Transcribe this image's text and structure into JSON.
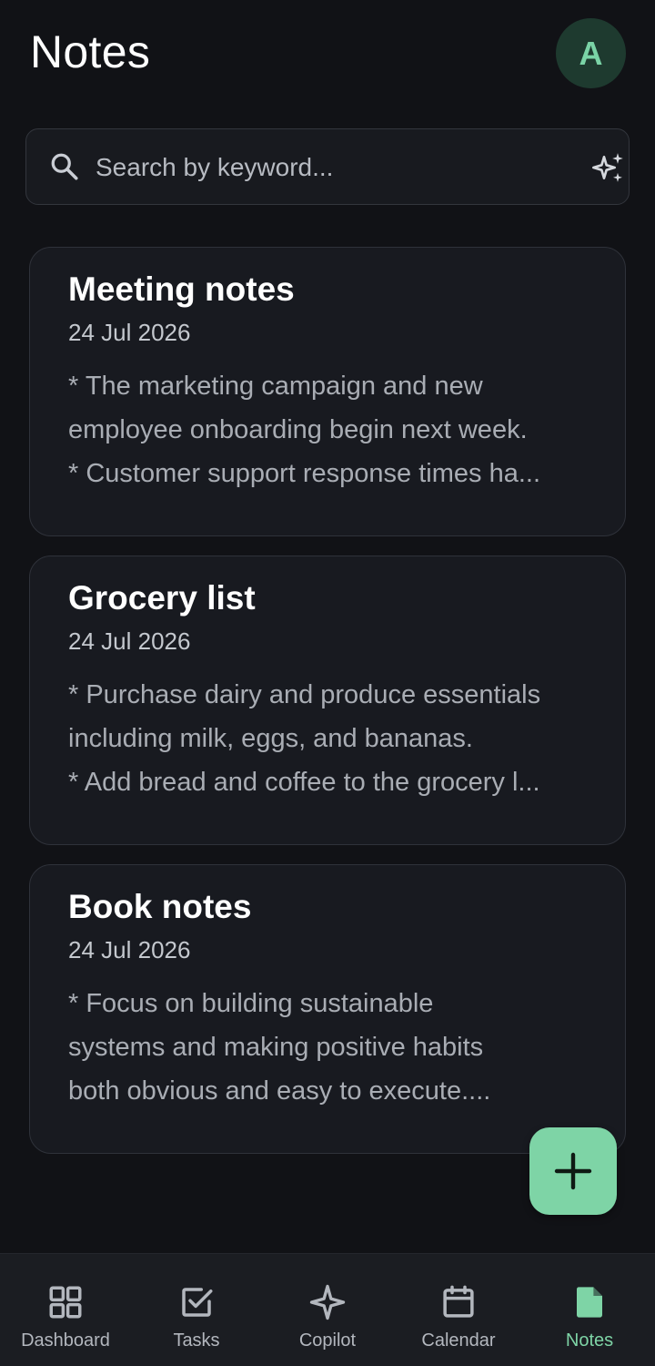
{
  "header": {
    "title": "Notes",
    "avatar_initial": "A"
  },
  "search": {
    "placeholder": "Search by keyword..."
  },
  "notes": [
    {
      "title": "Meeting notes",
      "date": "24 Jul 2026",
      "lines": [
        "* The marketing campaign and new",
        "employee onboarding begin next week.",
        "* Customer support response times ha..."
      ]
    },
    {
      "title": "Grocery list",
      "date": "24 Jul 2026",
      "lines": [
        "* Purchase dairy and produce essentials",
        "including milk, eggs, and bananas.",
        "* Add bread and coffee to the grocery l..."
      ]
    },
    {
      "title": "Book notes",
      "date": "24 Jul 2026",
      "lines": [
        "* Focus on building sustainable",
        "systems and making positive habits",
        "both obvious and easy to execute...."
      ]
    }
  ],
  "fab": {
    "icon": "plus-icon"
  },
  "nav": [
    {
      "label": "Dashboard",
      "icon": "dashboard-icon",
      "active": false
    },
    {
      "label": "Tasks",
      "icon": "tasks-icon",
      "active": false
    },
    {
      "label": "Copilot",
      "icon": "copilot-icon",
      "active": false
    },
    {
      "label": "Calendar",
      "icon": "calendar-icon",
      "active": false
    },
    {
      "label": "Notes",
      "icon": "notes-icon",
      "active": true
    }
  ],
  "colors": {
    "background": "#111216",
    "card": "#181a20",
    "accent": "#7ed4a6",
    "avatar_bg": "#1e3a2f"
  }
}
